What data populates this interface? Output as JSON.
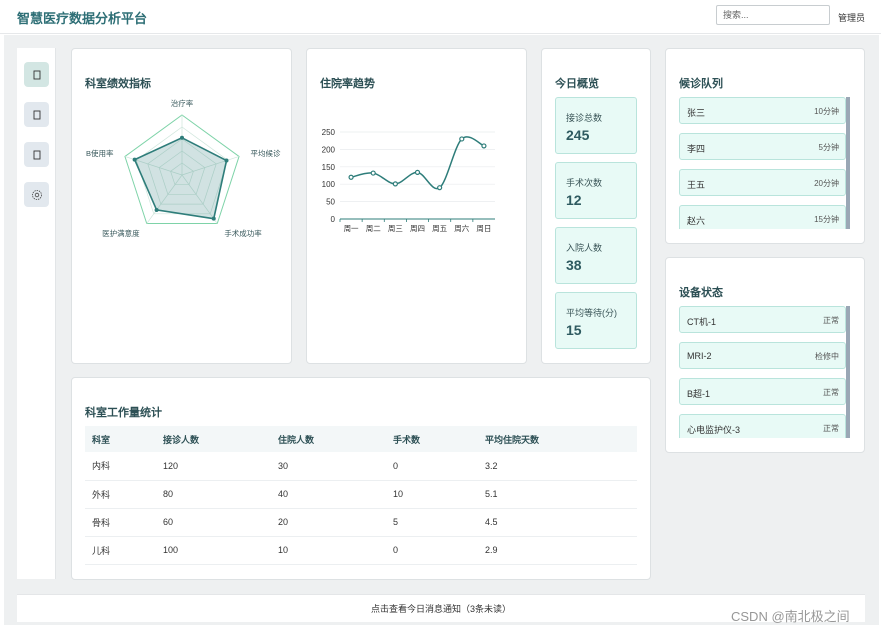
{
  "header": {
    "title": "智慧医疗数据分析平台",
    "search_placeholder": "搜索...",
    "user": "管理员"
  },
  "sidebar": {
    "items": [
      {
        "icon": "dashboard-icon",
        "active": true
      },
      {
        "icon": "document-icon",
        "active": false
      },
      {
        "icon": "calendar-icon",
        "active": false
      },
      {
        "icon": "settings-icon",
        "active": false
      }
    ]
  },
  "radar_card": {
    "title": "科室绩效指标",
    "chart_data": {
      "type": "radar",
      "indicators": [
        "治疗率",
        "平均候诊",
        "手术成功率",
        "医护满意度",
        "床位使用率"
      ],
      "indicator_labels_visible": [
        "治疗率",
        "平均候诊",
        "手术成功率",
        "医护满意度",
        "B使用率"
      ],
      "series": [
        {
          "values": [
            0.62,
            0.78,
            0.9,
            0.72,
            0.83
          ]
        }
      ]
    }
  },
  "line_card": {
    "title": "住院率趋势",
    "chart_data": {
      "type": "line",
      "x": [
        "周一",
        "周二",
        "周三",
        "周四",
        "周五",
        "周六",
        "周日"
      ],
      "values": [
        120,
        132,
        101,
        134,
        90,
        230,
        210
      ],
      "ylim": [
        0,
        250
      ],
      "yticks": [
        0,
        50,
        100,
        150,
        200,
        250
      ],
      "smooth": true
    }
  },
  "overview": {
    "title": "今日概览",
    "stats": [
      {
        "label": "接诊总数",
        "value": "245"
      },
      {
        "label": "手术次数",
        "value": "12"
      },
      {
        "label": "入院人数",
        "value": "38"
      },
      {
        "label": "平均等待(分)",
        "value": "15"
      }
    ]
  },
  "queue": {
    "title": "候诊队列",
    "items": [
      {
        "name": "张三",
        "meta": "10分钟"
      },
      {
        "name": "李四",
        "meta": "5分钟"
      },
      {
        "name": "王五",
        "meta": "20分钟"
      },
      {
        "name": "赵六",
        "meta": "15分钟"
      }
    ]
  },
  "devices": {
    "title": "设备状态",
    "items": [
      {
        "name": "CT机-1",
        "meta": "正常"
      },
      {
        "name": "MRI-2",
        "meta": "检修中"
      },
      {
        "name": "B超-1",
        "meta": "正常"
      },
      {
        "name": "心电监护仪-3",
        "meta": "正常"
      }
    ]
  },
  "workload": {
    "title": "科室工作量统计",
    "columns": [
      "科室",
      "接诊人数",
      "住院人数",
      "手术数",
      "平均住院天数"
    ],
    "rows": [
      [
        "内科",
        "120",
        "30",
        "0",
        "3.2"
      ],
      [
        "外科",
        "80",
        "40",
        "10",
        "5.1"
      ],
      [
        "骨科",
        "60",
        "20",
        "5",
        "4.5"
      ],
      [
        "儿科",
        "100",
        "10",
        "0",
        "2.9"
      ]
    ]
  },
  "footer": {
    "text": "点击查看今日消息通知（3条未读）"
  },
  "watermark": "CSDN @南北极之间",
  "colors": {
    "accent": "#2e7d7a",
    "card_fill": "#e8faf6",
    "title": "#2e6f76"
  }
}
